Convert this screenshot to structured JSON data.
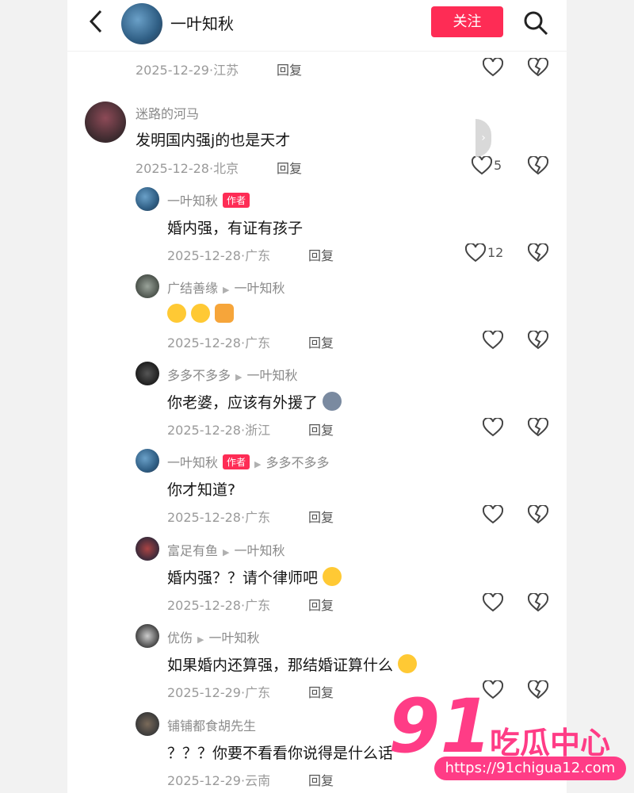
{
  "header": {
    "name": "一叶知秋",
    "follow_label": "关注"
  },
  "top_meta": {
    "date_loc": "2025-12-29·江苏",
    "reply": "回复"
  },
  "comments": [
    {
      "user": "迷路的河马",
      "text": "发明国内强j的也是天才",
      "date_loc": "2025-12-28·北京",
      "reply": "回复",
      "likes": "5"
    },
    {
      "user": "一叶知秋",
      "tag": "作者",
      "text": "婚内强，有证有孩子",
      "date_loc": "2025-12-28·广东",
      "reply": "回复",
      "likes": "12"
    },
    {
      "user": "广结善缘",
      "reply_to": "一叶知秋",
      "text": "",
      "date_loc": "2025-12-28·广东",
      "reply": "回复"
    },
    {
      "user": "多多不多多",
      "reply_to": "一叶知秋",
      "text": "你老婆，应该有外援了",
      "date_loc": "2025-12-28·浙江",
      "reply": "回复"
    },
    {
      "user": "一叶知秋",
      "tag": "作者",
      "reply_to": "多多不多多",
      "text": "你才知道?",
      "date_loc": "2025-12-28·广东",
      "reply": "回复"
    },
    {
      "user": "富足有鱼",
      "reply_to": "一叶知秋",
      "text": "婚内强？？请个律师吧",
      "date_loc": "2025-12-28·广东",
      "reply": "回复"
    },
    {
      "user": "优伤",
      "reply_to": "一叶知秋",
      "text": "如果婚内还算强，那结婚证算什么",
      "date_loc": "2025-12-29·广东",
      "reply": "回复"
    },
    {
      "user": "铺铺都食胡先生",
      "text": "？？？你要不看看你说得是什么话",
      "date_loc": "2025-12-29·云南",
      "reply": "回复"
    }
  ],
  "watermark": {
    "number": "91",
    "brand": "吃瓜中心",
    "url": "https://91chigua12.com"
  },
  "colors": {
    "accent": "#fe2c55",
    "watermark": "#ff3c86"
  }
}
